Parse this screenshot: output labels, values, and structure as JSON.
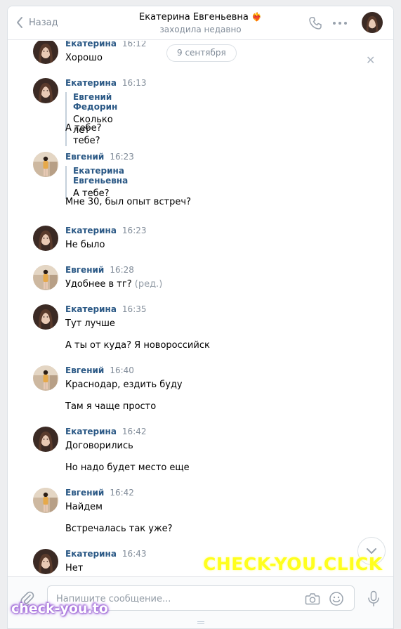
{
  "header": {
    "back_label": "Назад",
    "title": "Екатерина Евгеньевна",
    "title_emoji": "❤️‍🔥",
    "status": "заходила недавно"
  },
  "feed": {
    "date_separator": "9 сентября",
    "messages": [
      {
        "author": "Екатерина",
        "time": "16:12",
        "avatar": "katerina",
        "lines": [
          "Хорошо"
        ]
      },
      {
        "author": "Екатерина",
        "time": "16:13",
        "avatar": "katerina",
        "quote": {
          "author": "Евгений Федорин",
          "text": "Сколько лет тебе?"
        },
        "lines": [
          "А тебе?"
        ]
      },
      {
        "author": "Евгений",
        "time": "16:23",
        "avatar": "evgeny",
        "quote": {
          "author": "Екатерина Евгеньевна",
          "text": "А тебе?"
        },
        "lines": [
          "Мне 30, был опыт встреч?"
        ]
      },
      {
        "author": "Екатерина",
        "time": "16:23",
        "avatar": "katerina",
        "lines": [
          "Не было"
        ]
      },
      {
        "author": "Евгений",
        "time": "16:28",
        "avatar": "evgeny",
        "lines": [
          "Удобнее в тг?"
        ],
        "edited": "(ред.)"
      },
      {
        "author": "Екатерина",
        "time": "16:35",
        "avatar": "katerina",
        "lines": [
          "Тут лучше",
          "А ты от куда? Я новороссийск"
        ]
      },
      {
        "author": "Евгений",
        "time": "16:40",
        "avatar": "evgeny",
        "lines": [
          "Краснодар, ездить буду",
          "Там я чаще просто"
        ]
      },
      {
        "author": "Екатерина",
        "time": "16:42",
        "avatar": "katerina",
        "lines": [
          "Договорились",
          "Но надо будет место еще"
        ]
      },
      {
        "author": "Евгений",
        "time": "16:42",
        "avatar": "evgeny",
        "lines": [
          "Найдем",
          "Встречалась так уже?"
        ]
      },
      {
        "author": "Екатерина",
        "time": "16:43",
        "avatar": "katerina",
        "lines": [
          "Нет"
        ]
      }
    ]
  },
  "composer": {
    "placeholder": "Напишите сообщение..."
  },
  "watermarks": {
    "top": "CHECK-YOU.CLICK",
    "bottom": "check-you.to"
  },
  "colors": {
    "author": "#2a5885",
    "meta": "#818c99",
    "accent": "#5181b8",
    "background": "#edeef0"
  },
  "icons": [
    "chevron-left-icon",
    "phone-icon",
    "more-icon",
    "close-icon",
    "chevron-down-icon",
    "paperclip-icon",
    "camera-icon",
    "emoji-icon",
    "microphone-icon"
  ]
}
